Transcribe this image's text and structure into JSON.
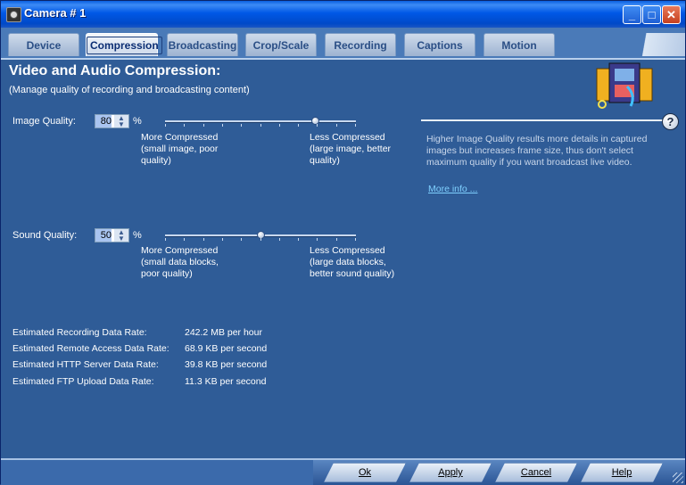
{
  "window": {
    "title": "Camera # 1"
  },
  "tabs": [
    {
      "label": "Device",
      "active": false
    },
    {
      "label": "Compression",
      "active": true
    },
    {
      "label": "Broadcasting",
      "active": false
    },
    {
      "label": "Crop/Scale",
      "active": false
    },
    {
      "label": "Recording",
      "active": false
    },
    {
      "label": "Captions",
      "active": false
    },
    {
      "label": "Motion",
      "active": false
    }
  ],
  "content": {
    "heading": "Video and Audio Compression:",
    "subheading": "(Manage quality of recording and broadcasting content)"
  },
  "image_quality": {
    "label": "Image Quality:",
    "value": "80",
    "unit": "%",
    "min_text": "More Compressed\n(small image, poor\nquality)",
    "max_text": "Less Compressed\n(large image, better\nquality)",
    "level": 0.8
  },
  "sound_quality": {
    "label": "Sound Quality:",
    "value": "50",
    "unit": "%",
    "min_text": "More Compressed\n(small data blocks,\npoor quality)",
    "max_text": "Less Compressed\n(large data blocks,\nbetter sound quality)",
    "level": 0.5
  },
  "info": {
    "help_symbol": "?",
    "text": "Higher Image Quality results more details in captured images but increases frame size, thus don't select maximum quality if you want broadcast live video.",
    "more_link": "More info ..."
  },
  "rates": [
    {
      "label": "Estimated Recording Data Rate:",
      "value": "242.2 MB per hour"
    },
    {
      "label": "Estimated Remote Access Data Rate:",
      "value": "68.9 KB per second"
    },
    {
      "label": "Estimated HTTP Server Data Rate:",
      "value": "39.8 KB per second"
    },
    {
      "label": "Estimated FTP Upload Data Rate:",
      "value": "11.3 KB per second"
    }
  ],
  "buttons": {
    "ok": "Ok",
    "apply": "Apply",
    "cancel": "Cancel",
    "help": "Help"
  }
}
